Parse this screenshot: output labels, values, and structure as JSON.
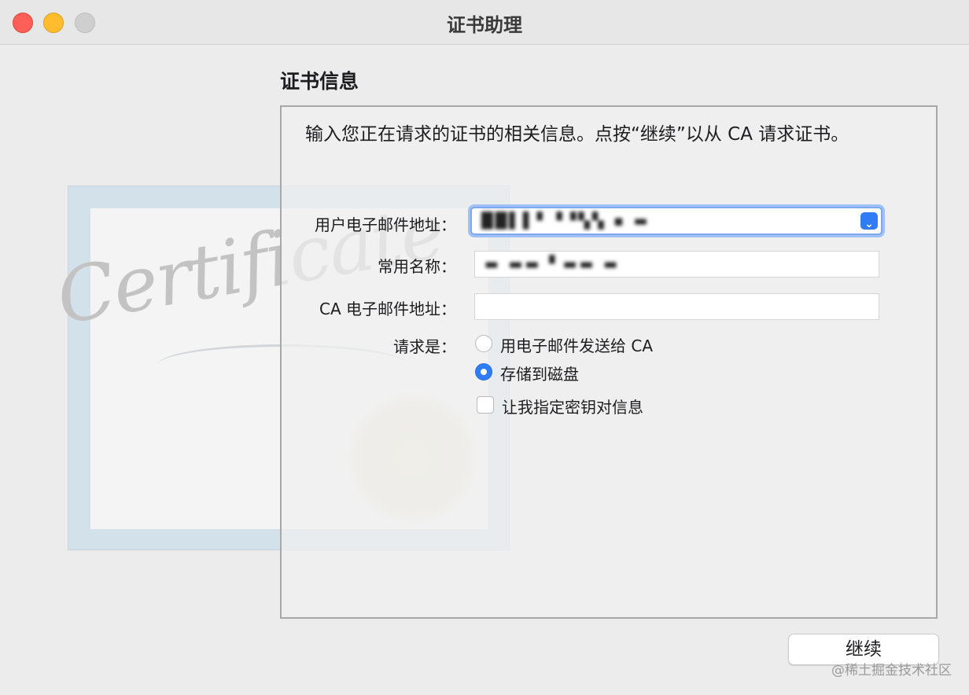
{
  "window": {
    "title": "证书助理"
  },
  "illustration": {
    "text": "Certificate"
  },
  "section": {
    "title": "证书信息",
    "intro": "输入您正在请求的证书的相关信息。点按“继续”以从 CA 请求证书。"
  },
  "form": {
    "user_email": {
      "label": "用户电子邮件地址：",
      "value": "██▌▌▘▝▝▚▚  ▪ ▬"
    },
    "common_name": {
      "label": "常用名称：",
      "value": "▬ ▬▬ ▘▬▬ ▬"
    },
    "ca_email": {
      "label": "CA 电子邮件地址：",
      "value": ""
    },
    "request": {
      "label": "请求是：",
      "options": [
        {
          "label": "用电子邮件发送给 CA",
          "selected": false
        },
        {
          "label": "存储到磁盘",
          "selected": true
        }
      ]
    },
    "specify_key": {
      "label": "让我指定密钥对信息",
      "checked": false
    }
  },
  "footer": {
    "continue_label": "继续",
    "watermark": "@稀土掘金技术社区"
  },
  "colors": {
    "accent": "#2f7cf6",
    "close": "#fe5f57",
    "minimize": "#febc2e",
    "zoom": "#cfcfcf"
  },
  "icons": {
    "close": "close-icon",
    "minimize": "minimize-icon",
    "zoom": "zoom-icon",
    "dropdown": "chevron-down-icon"
  }
}
